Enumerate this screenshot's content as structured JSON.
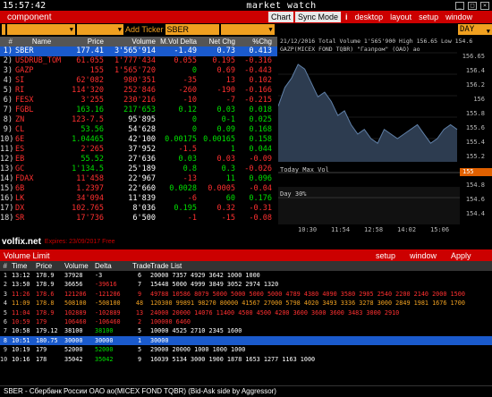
{
  "titlebar": {
    "clock": "15:57:42",
    "title": "market watch"
  },
  "menubar": {
    "component": "component",
    "buttons": [
      "Chart",
      "Sync Mode",
      "desktop",
      "layout",
      "setup",
      "window"
    ],
    "info_icon": "i"
  },
  "toolbar": {
    "add_ticker_label": "Add Ticker",
    "ticker_value": "SBER",
    "period_value": "DAY"
  },
  "watch": {
    "headers": [
      "#",
      "Name",
      "Price",
      "Volume",
      "M.Vol Delta",
      "Net Chg",
      "%Chg"
    ],
    "rows": [
      {
        "num": "1)",
        "name": "SBER",
        "price": "177.41",
        "volume": "3'565'914",
        "mvd": "-1.49",
        "net": "0.73",
        "chg": "0.413",
        "nc": "#fff",
        "pc": "#00e000",
        "vc": "#fff",
        "dc": "#ff3030",
        "gc": "#00e000",
        "hc": "#00e000",
        "sel": true
      },
      {
        "num": "2)",
        "name": "USDRUB_TOM",
        "price": "61.055",
        "volume": "1'777'434",
        "mvd": "0.055",
        "net": "0.195",
        "chg": "-0.316",
        "nc": "#ff3030",
        "pc": "#ff3030",
        "vc": "#ff3030",
        "dc": "#ff3030",
        "gc": "#ff3030",
        "hc": "#ff3030",
        "sel": false
      },
      {
        "num": "3)",
        "name": "GAZP",
        "price": "155",
        "volume": "1'565'720",
        "mvd": "0",
        "net": "0.69",
        "chg": "-0.443",
        "nc": "#ff3030",
        "pc": "#ff3030",
        "vc": "#ff3030",
        "dc": "#00e000",
        "gc": "#ff3030",
        "hc": "#ff3030",
        "sel": false
      },
      {
        "num": "4)",
        "name": "SI",
        "price": "62'082",
        "volume": "980'351",
        "mvd": "-35",
        "net": "13",
        "chg": "0.102",
        "nc": "#ff3030",
        "pc": "#ff3030",
        "vc": "#ff3030",
        "dc": "#ff3030",
        "gc": "#ff3030",
        "hc": "#ff3030",
        "sel": false
      },
      {
        "num": "5)",
        "name": "RI",
        "price": "114'320",
        "volume": "252'846",
        "mvd": "-260",
        "net": "-190",
        "chg": "-0.166",
        "nc": "#ff3030",
        "pc": "#ff3030",
        "vc": "#ff3030",
        "dc": "#ff3030",
        "gc": "#ff3030",
        "hc": "#ff3030",
        "sel": false
      },
      {
        "num": "6)",
        "name": "FESX",
        "price": "3'255",
        "volume": "230'216",
        "mvd": "-10",
        "net": "-7",
        "chg": "-0.215",
        "nc": "#ff3030",
        "pc": "#ff3030",
        "vc": "#ff3030",
        "dc": "#ff3030",
        "gc": "#ff3030",
        "hc": "#ff3030",
        "sel": false
      },
      {
        "num": "7)",
        "name": "FGBL",
        "price": "163.16",
        "volume": "217'653",
        "mvd": "0.12",
        "net": "0.03",
        "chg": "0.018",
        "nc": "#ff3030",
        "pc": "#00e000",
        "vc": "#00e000",
        "dc": "#00e000",
        "gc": "#00e000",
        "hc": "#00e000",
        "sel": false
      },
      {
        "num": "8)",
        "name": "ZN",
        "price": "123-7.5",
        "volume": "95'895",
        "mvd": "0",
        "net": "0-1",
        "chg": "0.025",
        "nc": "#ff3030",
        "pc": "#ff3030",
        "vc": "#fff",
        "dc": "#00e000",
        "gc": "#00e000",
        "hc": "#00e000",
        "sel": false
      },
      {
        "num": "9)",
        "name": "CL",
        "price": "53.56",
        "volume": "54'628",
        "mvd": "0",
        "net": "0.09",
        "chg": "0.168",
        "nc": "#ff3030",
        "pc": "#00e000",
        "vc": "#fff",
        "dc": "#00e000",
        "gc": "#00e000",
        "hc": "#00e000",
        "sel": false
      },
      {
        "num": "10)",
        "name": "6E",
        "price": "1.04465",
        "volume": "42'100",
        "mvd": "0.00175",
        "net": "0.00165",
        "chg": "0.158",
        "nc": "#ff3030",
        "pc": "#00e000",
        "vc": "#fff",
        "dc": "#00e000",
        "gc": "#00e000",
        "hc": "#00e000",
        "sel": false
      },
      {
        "num": "11)",
        "name": "ES",
        "price": "2'265",
        "volume": "37'952",
        "mvd": "-1.5",
        "net": "1",
        "chg": "0.044",
        "nc": "#ff3030",
        "pc": "#ff3030",
        "vc": "#fff",
        "dc": "#ff3030",
        "gc": "#00e000",
        "hc": "#00e000",
        "sel": false
      },
      {
        "num": "12)",
        "name": "EB",
        "price": "55.52",
        "volume": "27'636",
        "mvd": "0.03",
        "net": "0.03",
        "chg": "-0.09",
        "nc": "#ff3030",
        "pc": "#00e000",
        "vc": "#fff",
        "dc": "#00e000",
        "gc": "#ff3030",
        "hc": "#ff3030",
        "sel": false
      },
      {
        "num": "13)",
        "name": "GC",
        "price": "1'134.5",
        "volume": "25'189",
        "mvd": "0.8",
        "net": "0.3",
        "chg": "-0.026",
        "nc": "#ff3030",
        "pc": "#00e000",
        "vc": "#fff",
        "dc": "#00e000",
        "gc": "#00e000",
        "hc": "#ff3030",
        "sel": false
      },
      {
        "num": "14)",
        "name": "FDAX",
        "price": "11'458",
        "volume": "22'967",
        "mvd": "-13",
        "net": "11",
        "chg": "0.096",
        "nc": "#ff3030",
        "pc": "#ff3030",
        "vc": "#fff",
        "dc": "#ff3030",
        "gc": "#00e000",
        "hc": "#00e000",
        "sel": false
      },
      {
        "num": "15)",
        "name": "6B",
        "price": "1.2397",
        "volume": "22'660",
        "mvd": "0.0028",
        "net": "0.0005",
        "chg": "-0.04",
        "nc": "#ff3030",
        "pc": "#ff3030",
        "vc": "#fff",
        "dc": "#00e000",
        "gc": "#ff3030",
        "hc": "#ff3030",
        "sel": false
      },
      {
        "num": "16)",
        "name": "LK",
        "price": "34'094",
        "volume": "11'839",
        "mvd": "-6",
        "net": "60",
        "chg": "0.176",
        "nc": "#ff3030",
        "pc": "#ff3030",
        "vc": "#fff",
        "dc": "#ff3030",
        "gc": "#00e000",
        "hc": "#00e000",
        "sel": false
      },
      {
        "num": "17)",
        "name": "DX",
        "price": "102.765",
        "volume": "8'036",
        "mvd": "0.195",
        "net": "0.32",
        "chg": "-0.31",
        "nc": "#ff3030",
        "pc": "#ff3030",
        "vc": "#fff",
        "dc": "#00e000",
        "gc": "#ff3030",
        "hc": "#ff3030",
        "sel": false
      },
      {
        "num": "18)",
        "name": "SR",
        "price": "17'736",
        "volume": "6'500",
        "mvd": "-1",
        "net": "-15",
        "chg": "-0.08",
        "nc": "#ff3030",
        "pc": "#ff3030",
        "vc": "#fff",
        "dc": "#ff3030",
        "gc": "#ff3030",
        "hc": "#ff3030",
        "sel": false
      }
    ]
  },
  "chart": {
    "header": "21/12/2016  Total Volume 1'565'900  High 156.65 Low 154.6",
    "subheader": "GAZP(MICEX FOND TQBR) \"Газпром\" (ОАО) ао",
    "ylabels": [
      "156.65",
      "156.4",
      "156.2",
      "156",
      "155.8",
      "155.6",
      "155.4",
      "155.2",
      "155",
      "154.8",
      "154.6",
      "154.4"
    ],
    "last_price": "155",
    "vol_label_1": "Today Max Vol",
    "vol_label_2": "Day 30%",
    "xlabels": [
      "10:30",
      "11:54",
      "12:58",
      "14:02",
      "15:06"
    ],
    "chart_data": {
      "type": "area",
      "y": [
        155.5,
        155.9,
        156.1,
        156.4,
        156.3,
        156.0,
        155.7,
        155.8,
        155.6,
        155.3,
        155.4,
        155.1,
        154.9,
        155.0,
        154.8,
        154.7,
        155.0,
        154.9,
        154.8,
        154.9,
        155.0,
        155.1,
        154.9,
        154.7,
        154.8,
        155.0,
        155.1,
        155.0
      ],
      "ylim": [
        154.3,
        156.65
      ]
    }
  },
  "watermark": {
    "logo": "volfix.net",
    "expiry": "Expires: 23/09/2017 Free"
  },
  "volume_limit": {
    "title": "Volume Limit",
    "buttons": [
      "setup",
      "window",
      "Apply"
    ],
    "headers": [
      "#",
      "Time",
      "Price",
      "Volume",
      "Delta",
      "Trade",
      "Trade List"
    ],
    "rows": [
      {
        "n": "1",
        "time": "13:12",
        "price": "178.9",
        "vol": "37928",
        "delta": "-3",
        "tr": "6",
        "list": "20000 7357 4929 3642 1000 1000",
        "c": "#fff",
        "dc": "#fff",
        "sel": false
      },
      {
        "n": "2",
        "time": "13:50",
        "price": "178.9",
        "vol": "36656",
        "delta": "-39616",
        "tr": "7",
        "list": "15448 5000 4999 3849 3052 2974 1320",
        "c": "#fff",
        "dc": "#ff3030",
        "sel": false
      },
      {
        "n": "3",
        "time": "11:26",
        "price": "178.6",
        "vol": "121206",
        "delta": "-121206",
        "tr": "9",
        "list": "49788 10586 8079 5000 5000 5000 5000 4789 4380 4090 3580 2905 2540 2200 2140 2000 1500",
        "c": "#ff3030",
        "dc": "#ff3030",
        "sel": false
      },
      {
        "n": "4",
        "time": "11:09",
        "price": "178.8",
        "vol": "508100",
        "delta": "-508100",
        "tr": "48",
        "list": "120300 99891 98270 80000 41567 27000 5798 4020 3493 3336 3278 3000 2849 1981 1676 1700",
        "c": "#f0a020",
        "dc": "#f0a020",
        "sel": false
      },
      {
        "n": "5",
        "time": "11:04",
        "price": "178.9",
        "vol": "102889",
        "delta": "-102889",
        "tr": "13",
        "list": "24000 20000 14076 11400 4500 4500 4200 3600 3600 3600 3483 3000 2910",
        "c": "#ff3030",
        "dc": "#ff3030",
        "sel": false
      },
      {
        "n": "6",
        "time": "10:59",
        "price": "179",
        "vol": "106460",
        "delta": "-106460",
        "tr": "2",
        "list": "100000 6460",
        "c": "#ff3030",
        "dc": "#ff3030",
        "sel": false
      },
      {
        "n": "7",
        "time": "10:58",
        "price": "179.12",
        "vol": "38100",
        "delta": "38100",
        "tr": "5",
        "list": "10000 4525 2710 2345 1600",
        "c": "#fff",
        "dc": "#00e000",
        "sel": false
      },
      {
        "n": "8",
        "time": "10:51",
        "price": "180.75",
        "vol": "30000",
        "delta": "30000",
        "tr": "1",
        "list": "30000",
        "c": "#fff",
        "dc": "#00e000",
        "sel": true
      },
      {
        "n": "9",
        "time": "10:19",
        "price": "179",
        "vol": "52000",
        "delta": "52000",
        "tr": "5",
        "list": "29000 20000 1000 1000 1000",
        "c": "#fff",
        "dc": "#00e000",
        "sel": false
      },
      {
        "n": "10",
        "time": "10:16",
        "price": "178",
        "vol": "35042",
        "delta": "35042",
        "tr": "9",
        "list": "16039 5134 3000 1900 1878 1653 1277 1163 1000",
        "c": "#fff",
        "dc": "#00e000",
        "sel": false
      }
    ]
  },
  "status": "SBER - Сбербанк России ОАО ао(MICEX FOND TQBR) (Bid-Ask side by Aggressor)",
  "colors": {
    "accent_red": "#cc0000",
    "accent_orange": "#f0a020",
    "select_blue": "#1a5acc"
  }
}
